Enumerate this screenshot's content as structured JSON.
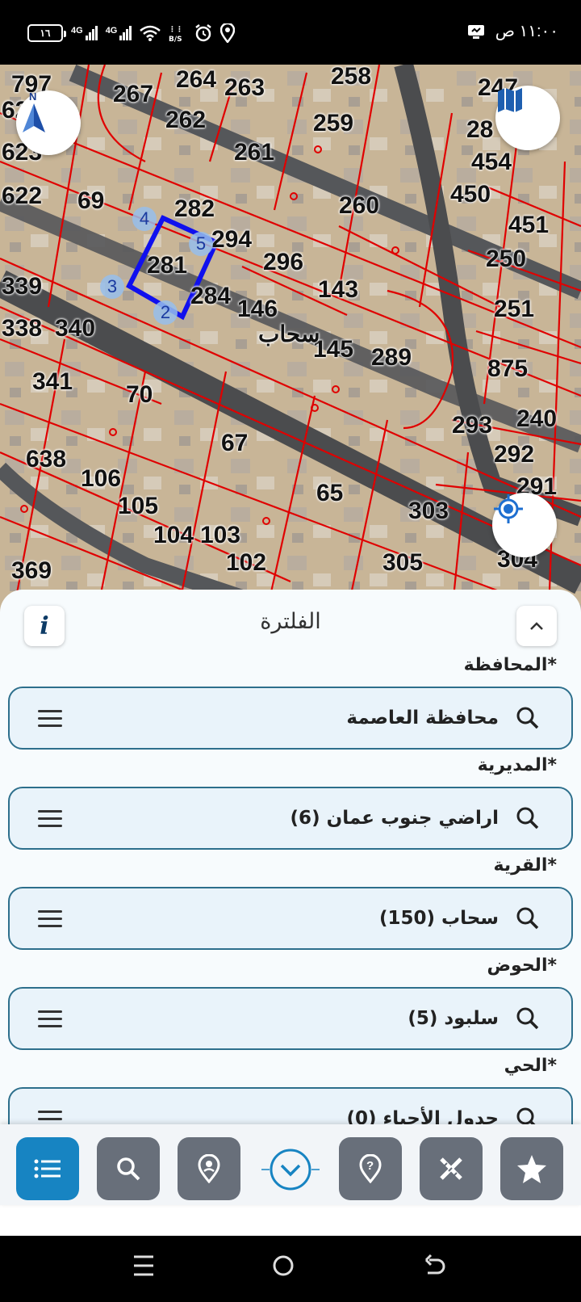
{
  "status_bar": {
    "battery": "١٦",
    "net1": "4G",
    "net2": "4G",
    "time": "١١:٠٠ ص"
  },
  "map": {
    "parcels": [
      {
        "label": "797"
      },
      {
        "label": "62"
      },
      {
        "label": "267"
      },
      {
        "label": "264"
      },
      {
        "label": "263"
      },
      {
        "label": "258"
      },
      {
        "label": "247"
      },
      {
        "label": "262"
      },
      {
        "label": "259"
      },
      {
        "label": "28"
      },
      {
        "label": "623"
      },
      {
        "label": "261"
      },
      {
        "label": "454"
      },
      {
        "label": "622"
      },
      {
        "label": "69"
      },
      {
        "label": "282"
      },
      {
        "label": "260"
      },
      {
        "label": "450"
      },
      {
        "label": "451"
      },
      {
        "label": "294"
      },
      {
        "label": "281"
      },
      {
        "label": "296"
      },
      {
        "label": "250"
      },
      {
        "label": "339"
      },
      {
        "label": "284"
      },
      {
        "label": "143"
      },
      {
        "label": "146"
      },
      {
        "label": "251"
      },
      {
        "label": "338"
      },
      {
        "label": "340"
      },
      {
        "label": "145"
      },
      {
        "label": "289"
      },
      {
        "label": "875"
      },
      {
        "label": "341"
      },
      {
        "label": "70"
      },
      {
        "label": "293"
      },
      {
        "label": "240"
      },
      {
        "label": "67"
      },
      {
        "label": "292"
      },
      {
        "label": "638"
      },
      {
        "label": "106"
      },
      {
        "label": "65"
      },
      {
        "label": "291"
      },
      {
        "label": "105"
      },
      {
        "label": "303"
      },
      {
        "label": "104"
      },
      {
        "label": "103"
      },
      {
        "label": "102"
      },
      {
        "label": "305"
      },
      {
        "label": "304"
      },
      {
        "label": "369"
      }
    ],
    "area_name": "سحاب",
    "vertices": [
      "2",
      "3",
      "4",
      "5"
    ],
    "compass_letter": "N"
  },
  "filter": {
    "title": "الفلترة",
    "info_label": "i",
    "fields": [
      {
        "label": "المحافظة*",
        "value": "محافظة العاصمة"
      },
      {
        "label": "المديرية*",
        "value": "اراضي جنوب عمان (6)"
      },
      {
        "label": "القرية*",
        "value": "سحاب (150)"
      },
      {
        "label": "الحوض*",
        "value": "سلبود (5)"
      },
      {
        "label": "الحي*",
        "value": "جدول الأحياء (0)"
      }
    ]
  },
  "colors": {
    "accent": "#1784c2",
    "inactive": "#686f7a",
    "field_border": "#2d6f8c",
    "parcel_line": "#e00000",
    "selection": "#1010ee"
  }
}
